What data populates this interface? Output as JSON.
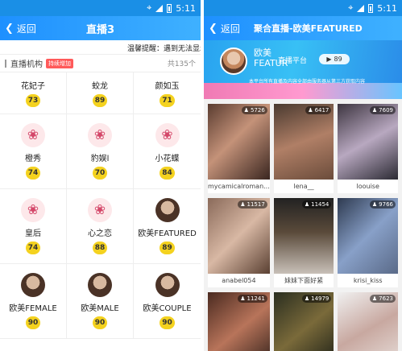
{
  "left": {
    "status_time": "5:11",
    "header": {
      "back_label": "返回",
      "title": "直播3"
    },
    "notice": "温馨提醒：遇到无法显示",
    "section": {
      "title": "直播机构",
      "tag": "持续增加",
      "count": "共135个"
    },
    "channels": [
      {
        "name": "花妃子",
        "count": "73",
        "icon": "none"
      },
      {
        "name": "蛟龙",
        "count": "89",
        "icon": "none"
      },
      {
        "name": "颜如玉",
        "count": "71",
        "icon": "none"
      },
      {
        "name": "橙秀",
        "count": "74",
        "icon": "lotus-icon"
      },
      {
        "name": "豹娱l",
        "count": "70",
        "icon": "lotus-icon"
      },
      {
        "name": "小花蝶",
        "count": "84",
        "icon": "lotus-icon"
      },
      {
        "name": "皇后",
        "count": "74",
        "icon": "lotus-icon"
      },
      {
        "name": "心之恋",
        "count": "88",
        "icon": "lotus-icon"
      },
      {
        "name": "欧美FEATURED",
        "count": "89",
        "icon": "photo"
      },
      {
        "name": "欧美FEMALE",
        "count": "90",
        "icon": "photo"
      },
      {
        "name": "欧美MALE",
        "count": "90",
        "icon": "photo"
      },
      {
        "name": "欧美COUPLE",
        "count": "90",
        "icon": "photo"
      }
    ]
  },
  "right": {
    "status_time": "5:11",
    "header": {
      "back_label": "返回",
      "title": "聚合直播-欧美FEATURED"
    },
    "banner": {
      "name": "欧美",
      "name_sub": "FEATUR",
      "platform": "直播平台",
      "count": "89",
      "desc": "本平台所有直播及内容全部由服务器从第三方获取内容"
    },
    "videos": [
      {
        "name": "mycamicalroman...",
        "viewers": "5726"
      },
      {
        "name": "lena__",
        "viewers": "6417"
      },
      {
        "name": "loouise",
        "viewers": "7609"
      },
      {
        "name": "anabel054",
        "viewers": "11517"
      },
      {
        "name": "妹妹下面好紧",
        "viewers": "11454"
      },
      {
        "name": "krisi_kiss",
        "viewers": "9766"
      },
      {
        "name": "",
        "viewers": "11241"
      },
      {
        "name": "",
        "viewers": "14979"
      },
      {
        "name": "",
        "viewers": "7623"
      }
    ]
  }
}
